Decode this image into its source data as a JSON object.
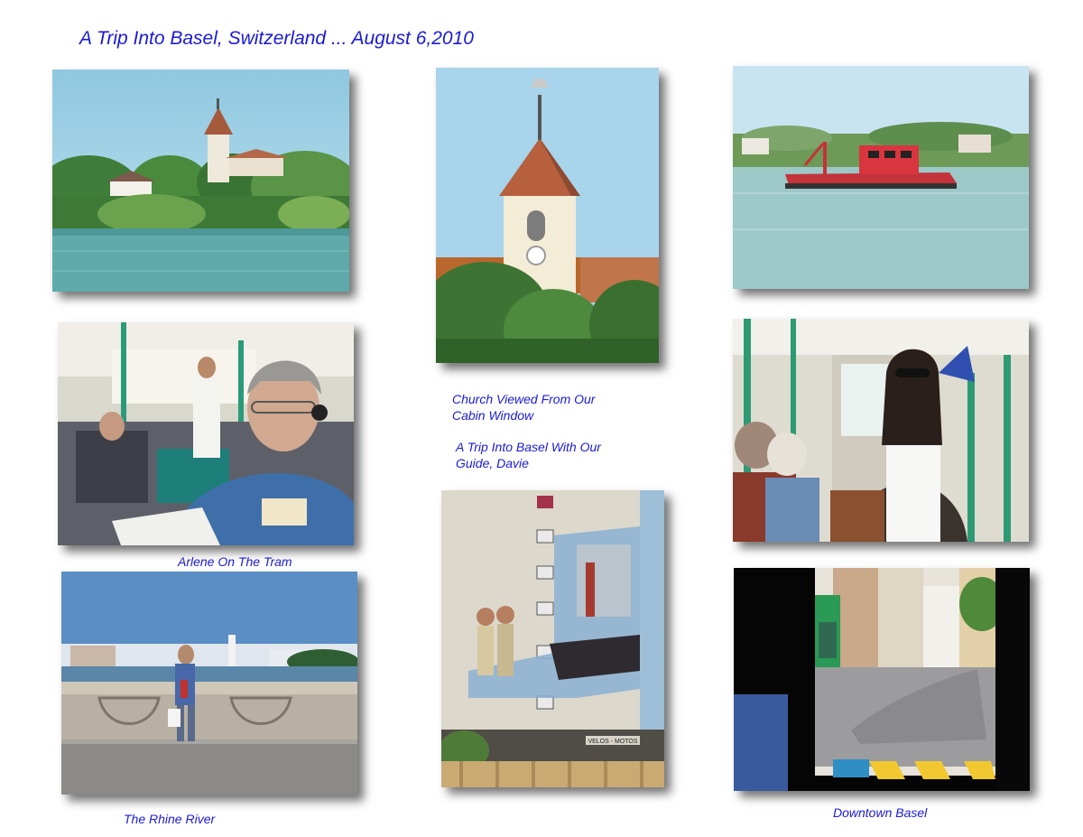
{
  "page": {
    "title": "A Trip Into Basel, Switzerland ... August 6,2010"
  },
  "captions": {
    "church": [
      "Church Viewed From Our",
      "Cabin Window"
    ],
    "guide": [
      "A Trip Into Basel With Our",
      "Guide, Davie"
    ],
    "tram": "Arlene On The Tram",
    "rhine": "The Rhine River",
    "downtown": "Downtown Basel"
  },
  "photos": {
    "mural_sign": "VELOS - MOTOS"
  },
  "colors": {
    "caption_text": "#1a1adb",
    "page_background": "#ffffff"
  }
}
